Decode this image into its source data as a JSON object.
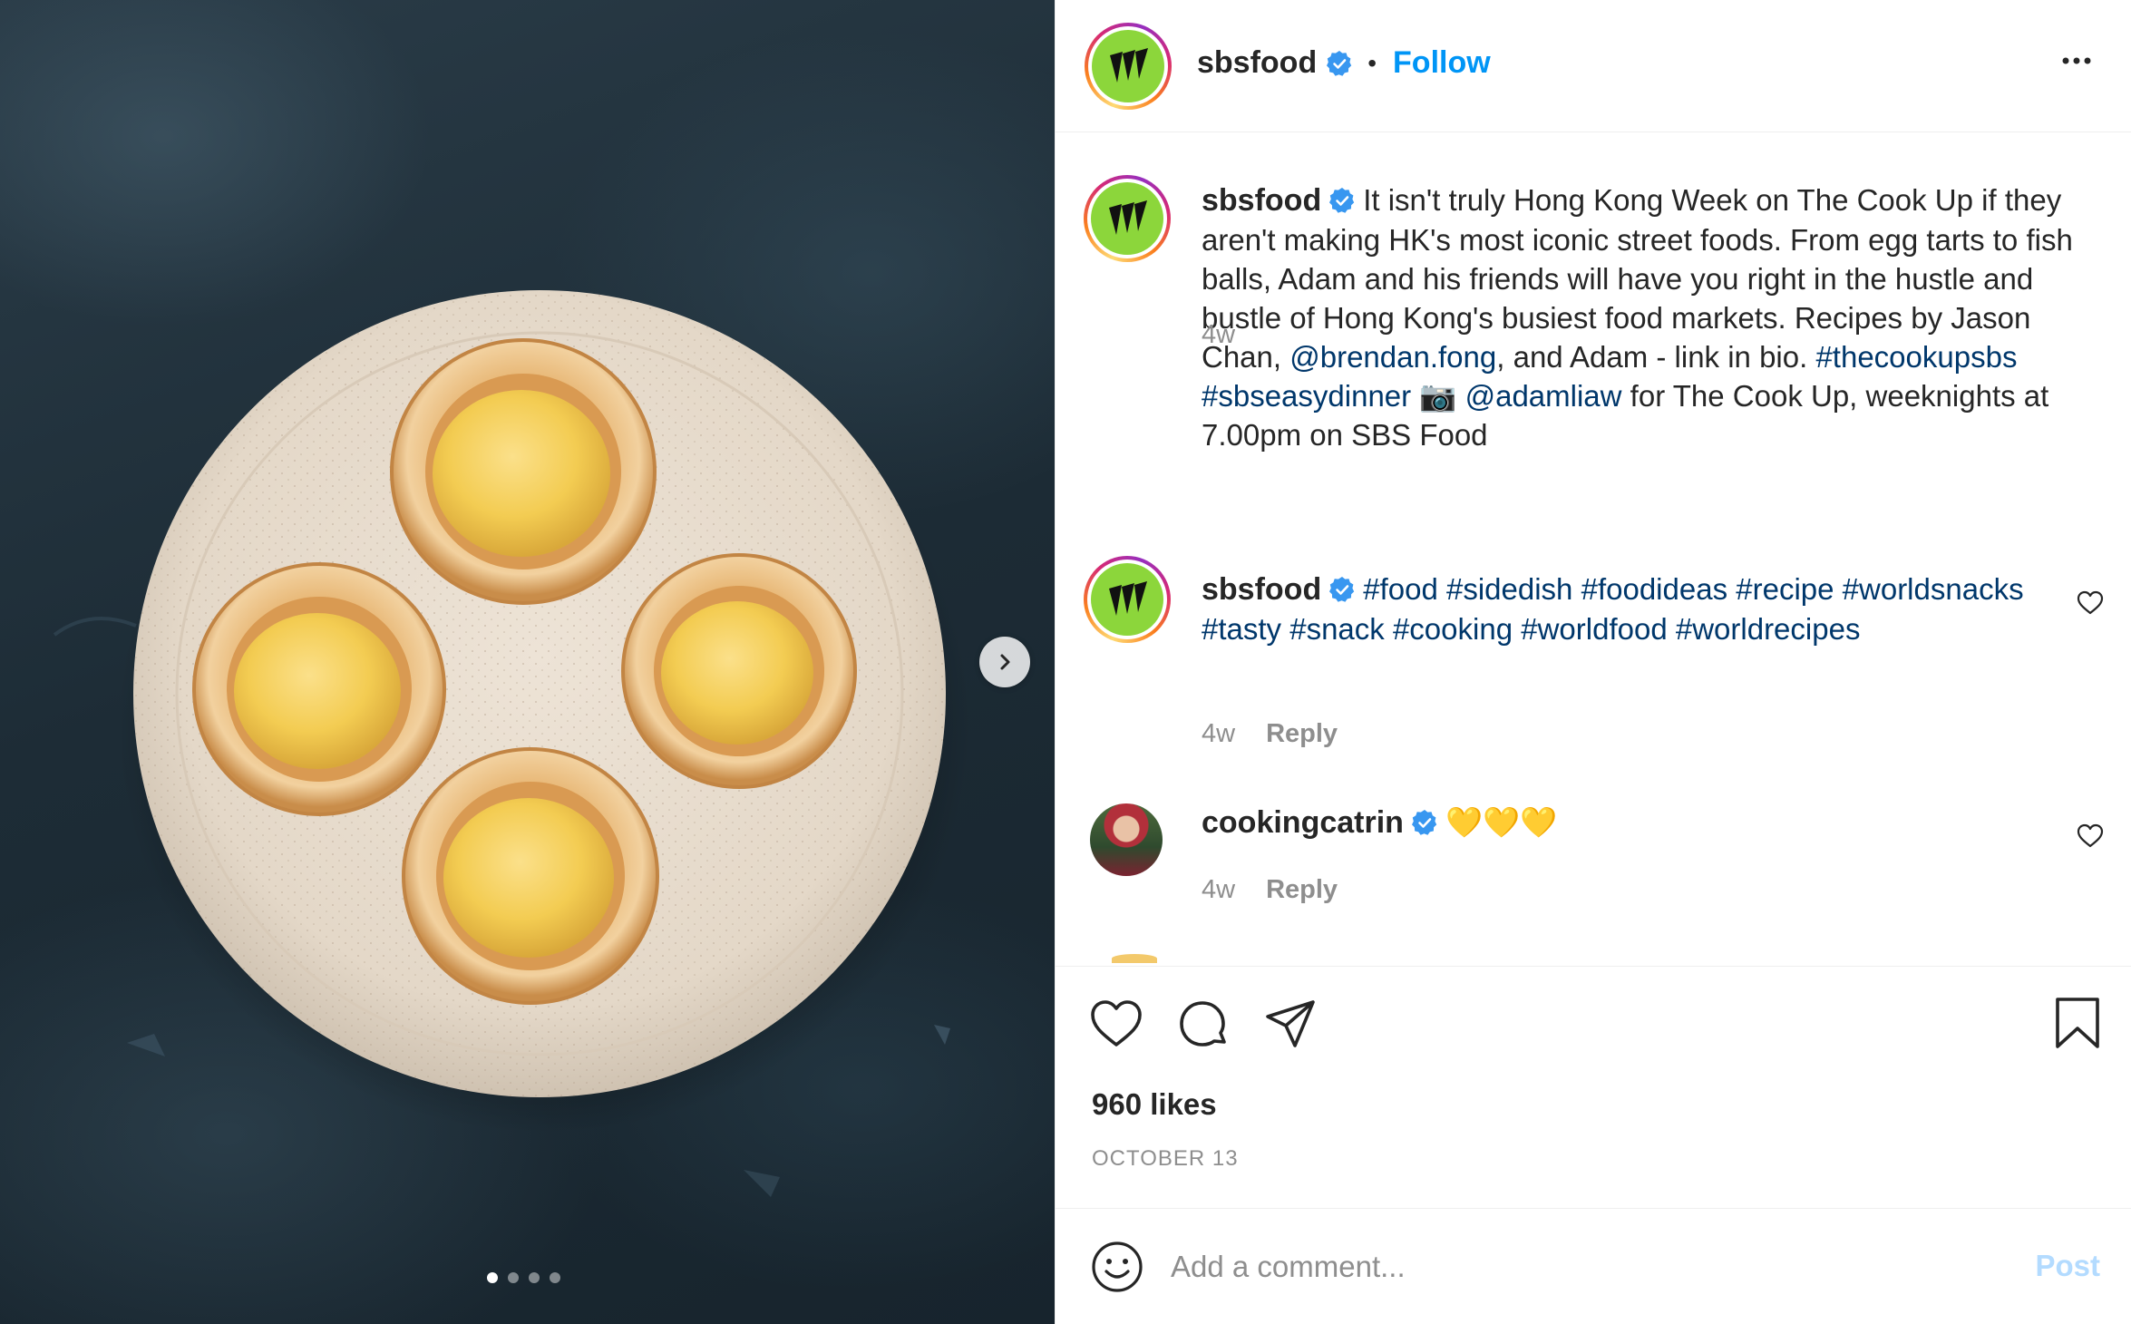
{
  "post": {
    "username": "sbsfood",
    "follow_label": "Follow",
    "separator": "•",
    "photo_alt": "egg tarts on a plate",
    "carousel_count": 4,
    "carousel_active": 0
  },
  "caption": {
    "username": "sbsfood",
    "text_1": "It isn't truly Hong Kong Week on The Cook Up if they aren't making HK's most iconic street foods. From egg tarts to fish balls, Adam and his friends will have you right in the hustle and bustle of Hong Kong's busiest food markets. Recipes by Jason Chan, ",
    "mention_1": "@brendan.fong",
    "text_2": ", and Adam - link in bio. ",
    "hashtag_1": "#thecookupsbs",
    "hashtag_2": "#sbseasydinner",
    "camera_emoji": "📷",
    "mention_2": "@adamliaw",
    "text_3": " for The Cook Up, weeknights at 7.00pm on SBS Food",
    "time": "4w"
  },
  "comments": [
    {
      "username": "sbsfood",
      "hashtags": [
        "#food",
        "#sidedish",
        "#foodideas",
        "#recipe",
        "#worldsnacks",
        "#tasty",
        "#snack",
        "#cooking",
        "#worldfood",
        "#worldrecipes"
      ],
      "time": "4w",
      "reply_label": "Reply"
    },
    {
      "username": "cookingcatrin",
      "text": "💛💛💛",
      "time": "4w",
      "reply_label": "Reply"
    }
  ],
  "actions": {
    "likes": "960 likes",
    "date": "OCTOBER 13"
  },
  "add_comment": {
    "placeholder": "Add a comment...",
    "post_label": "Post"
  },
  "colors": {
    "link": "#00376b",
    "follow": "#0095f6",
    "verified": "#3897f0",
    "muted": "#8e8e8e",
    "post_disabled": "#b3dbff",
    "brand_green": "#8cd63b"
  },
  "icons": [
    "chevron-right-icon",
    "verified-icon",
    "more-icon",
    "heart-icon",
    "comment-icon",
    "share-icon",
    "bookmark-icon",
    "emoji-icon"
  ]
}
